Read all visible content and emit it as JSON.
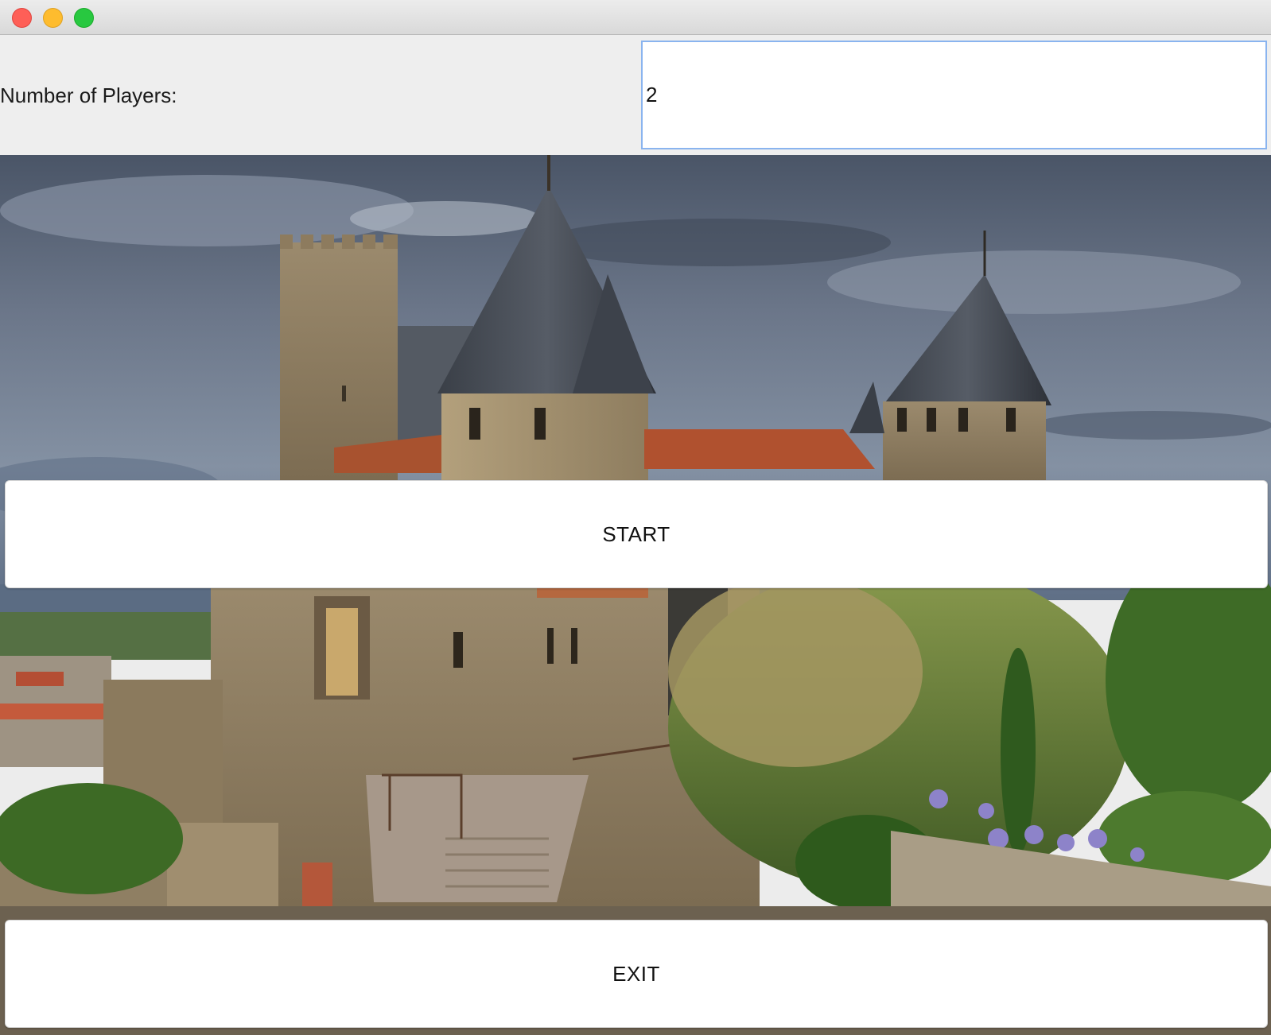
{
  "window": {
    "controls": [
      "close",
      "minimize",
      "zoom"
    ]
  },
  "form": {
    "players_label": "Number of Players:",
    "players_value": "2"
  },
  "buttons": {
    "start_label": "START",
    "exit_label": "EXIT"
  },
  "background": {
    "subject": "medieval castle with conical slate-roof towers, stone ramparts, gardens, cloudy sky"
  },
  "colors": {
    "close": "#fe5f57",
    "minimize": "#febc2e",
    "zoom": "#28c840",
    "input_focus_border": "#8ab4ef"
  }
}
